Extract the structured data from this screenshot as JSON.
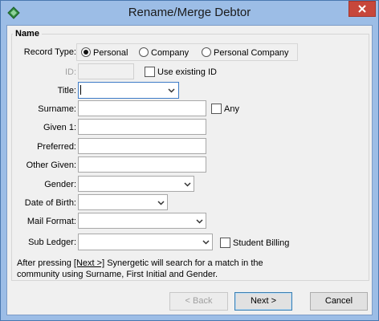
{
  "window": {
    "title": "Rename/Merge Debtor",
    "colors": {
      "titlebar": "#9cbde6",
      "close": "#c7473b",
      "client": "#f0f0f0"
    },
    "icons": {
      "app": "green-diamond-icon",
      "close": "close-x-icon"
    }
  },
  "group": {
    "title": "Name"
  },
  "record_type": {
    "label": "Record Type:",
    "options": [
      "Personal",
      "Company",
      "Personal Company"
    ],
    "selected": "Personal"
  },
  "id_field": {
    "label": "ID:",
    "value": ""
  },
  "use_existing_id": {
    "label": "Use existing ID",
    "checked": false
  },
  "fields": {
    "title": {
      "label": "Title:",
      "value": ""
    },
    "surname": {
      "label": "Surname:",
      "value": ""
    },
    "given1": {
      "label": "Given 1:",
      "value": ""
    },
    "preferred": {
      "label": "Preferred:",
      "value": ""
    },
    "other_given": {
      "label": "Other Given:",
      "value": ""
    },
    "gender": {
      "label": "Gender:",
      "value": ""
    },
    "dob": {
      "label": "Date of Birth:",
      "value": ""
    },
    "mail_format": {
      "label": "Mail Format:",
      "value": ""
    },
    "sub_ledger": {
      "label": "Sub Ledger:",
      "value": ""
    }
  },
  "any_check": {
    "label": "Any",
    "checked": false
  },
  "student_billing": {
    "label": "Student Billing",
    "checked": false
  },
  "note": {
    "before": "After pressing ",
    "key": "[Next >]",
    "after": " Synergetic will search for a match in the",
    "line2": "community using Surname, First Initial and Gender."
  },
  "buttons": {
    "back": "< Back",
    "next": "Next >",
    "cancel": "Cancel"
  }
}
